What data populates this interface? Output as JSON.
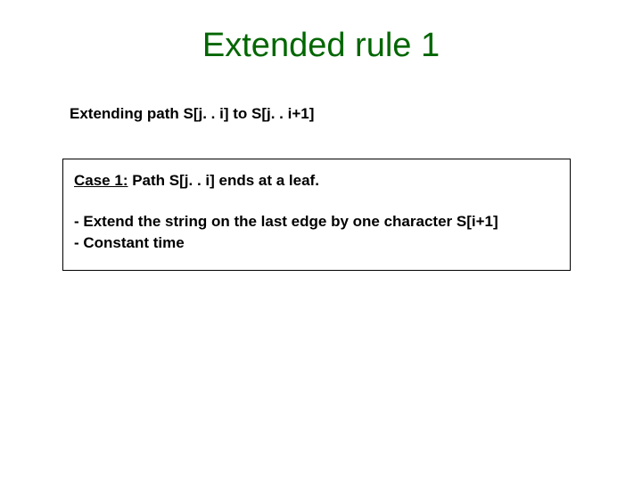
{
  "title": "Extended rule 1",
  "subhead": "Extending path S[j. . i] to S[j. . i+1]",
  "case": {
    "label": "Case 1:",
    "text": " Path S[j. . i] ends at a leaf."
  },
  "bullets": {
    "b1": "- Extend the string on the last edge by one character S[i+1]",
    "b2": "- Constant time"
  }
}
